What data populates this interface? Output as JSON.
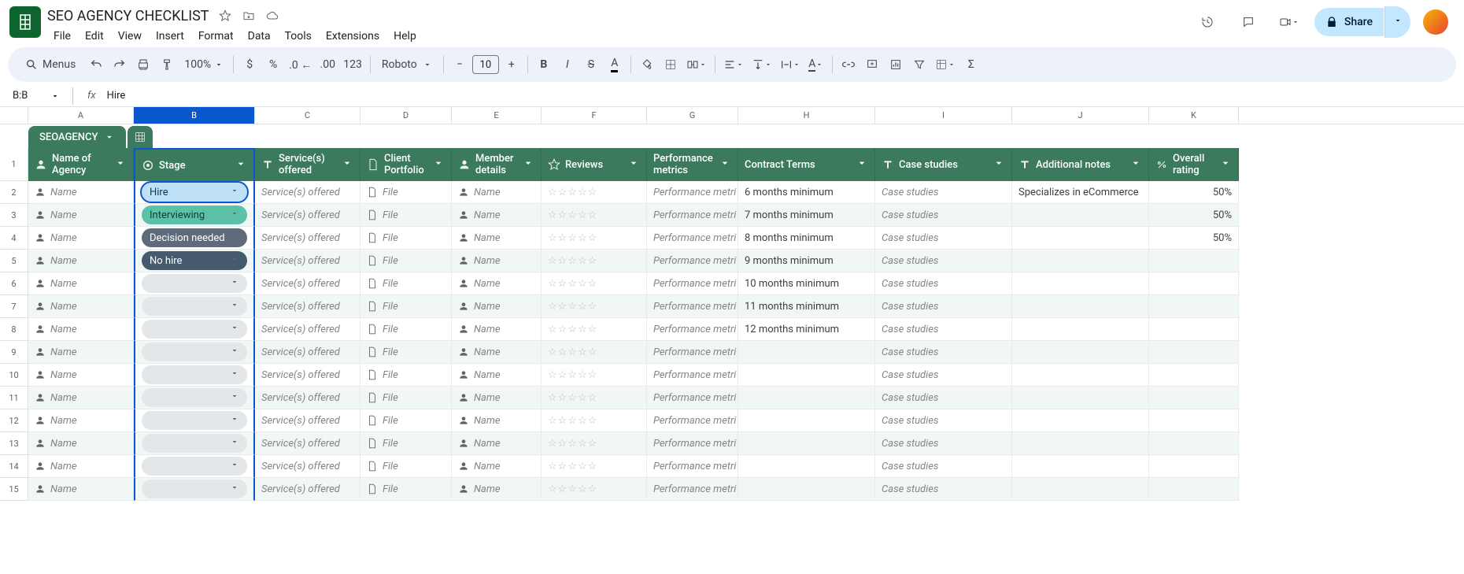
{
  "doc": {
    "title": "SEO AGENCY CHECKLIST"
  },
  "menus": [
    "File",
    "Edit",
    "View",
    "Insert",
    "Format",
    "Data",
    "Tools",
    "Extensions",
    "Help"
  ],
  "share": {
    "label": "Share"
  },
  "toolbar": {
    "menus_label": "Menus",
    "zoom": "100%",
    "font": "Roboto",
    "fsize": "10"
  },
  "namebox": "B:B",
  "formula": "Hire",
  "col_letters": [
    "A",
    "B",
    "C",
    "D",
    "E",
    "F",
    "G",
    "H",
    "I",
    "J",
    "K"
  ],
  "table_tab": "SEOAGENCY",
  "headers": {
    "name": "Name of Agency",
    "stage": "Stage",
    "services": "Service(s) offered",
    "portfolio": "Client Portfolio",
    "member": "Member details",
    "reviews": "Reviews",
    "perf": "Performance metrics",
    "contract": "Contract Terms",
    "cases": "Case studies",
    "notes": "Additional notes",
    "rating": "Overall rating"
  },
  "chips": {
    "name_placeholder": "Name",
    "file_placeholder": "File",
    "services_placeholder": "Service(s) offered",
    "perf_placeholder": "Performance metri",
    "cases_placeholder": "Case studies"
  },
  "stage_labels": {
    "hire": "Hire",
    "interviewing": "Interviewing",
    "decision": "Decision needed",
    "nohire": "No hire"
  },
  "rows": [
    {
      "n": 1,
      "stage": "hire",
      "contract": "6 months minimum",
      "notes": "Specializes in eCommerce",
      "rating": "50%"
    },
    {
      "n": 2,
      "stage": "interviewing",
      "contract": "7 months minimum",
      "notes": "",
      "rating": "50%"
    },
    {
      "n": 3,
      "stage": "decision",
      "contract": "8 months minimum",
      "notes": "",
      "rating": "50%"
    },
    {
      "n": 4,
      "stage": "nohire",
      "contract": "9 months minimum",
      "notes": "",
      "rating": ""
    },
    {
      "n": 5,
      "stage": "empty",
      "contract": "10 months minimum",
      "notes": "",
      "rating": ""
    },
    {
      "n": 6,
      "stage": "empty",
      "contract": "11 months minimum",
      "notes": "",
      "rating": ""
    },
    {
      "n": 7,
      "stage": "empty",
      "contract": "12 months minimum",
      "notes": "",
      "rating": ""
    },
    {
      "n": 8,
      "stage": "empty",
      "contract": "",
      "notes": "",
      "rating": ""
    },
    {
      "n": 9,
      "stage": "empty",
      "contract": "",
      "notes": "",
      "rating": ""
    },
    {
      "n": 10,
      "stage": "empty",
      "contract": "",
      "notes": "",
      "rating": ""
    },
    {
      "n": 11,
      "stage": "empty",
      "contract": "",
      "notes": "",
      "rating": ""
    },
    {
      "n": 12,
      "stage": "empty",
      "contract": "",
      "notes": "",
      "rating": ""
    },
    {
      "n": 13,
      "stage": "empty",
      "contract": "",
      "notes": "",
      "rating": ""
    },
    {
      "n": 14,
      "stage": "empty",
      "contract": "",
      "notes": "",
      "rating": ""
    }
  ]
}
